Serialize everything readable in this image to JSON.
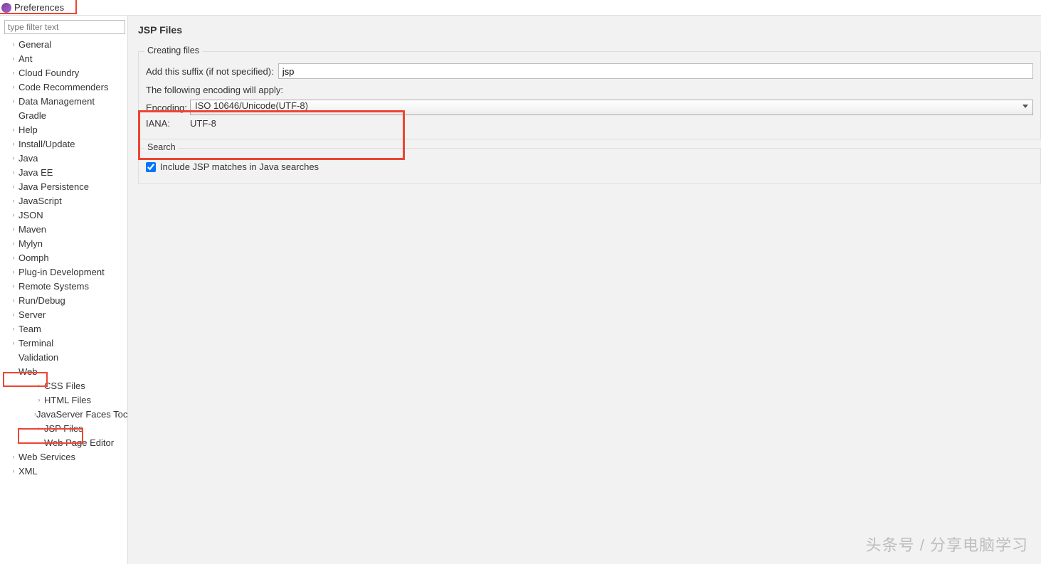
{
  "window": {
    "title": "Preferences"
  },
  "sidebar": {
    "filter_placeholder": "type filter text",
    "items": [
      {
        "label": "General",
        "expandable": true
      },
      {
        "label": "Ant",
        "expandable": true
      },
      {
        "label": "Cloud Foundry",
        "expandable": true
      },
      {
        "label": "Code Recommenders",
        "expandable": true
      },
      {
        "label": "Data Management",
        "expandable": true
      },
      {
        "label": "Gradle",
        "expandable": false
      },
      {
        "label": "Help",
        "expandable": true
      },
      {
        "label": "Install/Update",
        "expandable": true
      },
      {
        "label": "Java",
        "expandable": true
      },
      {
        "label": "Java EE",
        "expandable": true
      },
      {
        "label": "Java Persistence",
        "expandable": true
      },
      {
        "label": "JavaScript",
        "expandable": true
      },
      {
        "label": "JSON",
        "expandable": true
      },
      {
        "label": "Maven",
        "expandable": true
      },
      {
        "label": "Mylyn",
        "expandable": true
      },
      {
        "label": "Oomph",
        "expandable": true
      },
      {
        "label": "Plug-in Development",
        "expandable": true
      },
      {
        "label": "Remote Systems",
        "expandable": true
      },
      {
        "label": "Run/Debug",
        "expandable": true
      },
      {
        "label": "Server",
        "expandable": true
      },
      {
        "label": "Team",
        "expandable": true
      },
      {
        "label": "Terminal",
        "expandable": true
      },
      {
        "label": "Validation",
        "expandable": false
      },
      {
        "label": "Web",
        "expandable": true,
        "expanded": true,
        "children": [
          {
            "label": "CSS Files",
            "expandable": true
          },
          {
            "label": "HTML Files",
            "expandable": true
          },
          {
            "label": "JavaServer Faces Toc",
            "expandable": true
          },
          {
            "label": "JSP Files",
            "expandable": true,
            "selected": true
          },
          {
            "label": "Web Page Editor",
            "expandable": false
          }
        ]
      },
      {
        "label": "Web Services",
        "expandable": true
      },
      {
        "label": "XML",
        "expandable": true
      }
    ]
  },
  "main": {
    "title": "JSP Files",
    "creating": {
      "legend": "Creating files",
      "suffix_label": "Add this suffix (if not specified):",
      "suffix_value": "jsp",
      "following_text": "The following encoding will apply:",
      "encoding_label": "Encoding:",
      "encoding_value": "ISO 10646/Unicode(UTF-8)",
      "iana_label": "IANA:",
      "iana_value": "UTF-8"
    },
    "search": {
      "legend": "Search",
      "checkbox_label": "Include JSP matches in Java searches",
      "checkbox_checked": true
    }
  },
  "watermark": "头条号 / 分享电脑学习"
}
